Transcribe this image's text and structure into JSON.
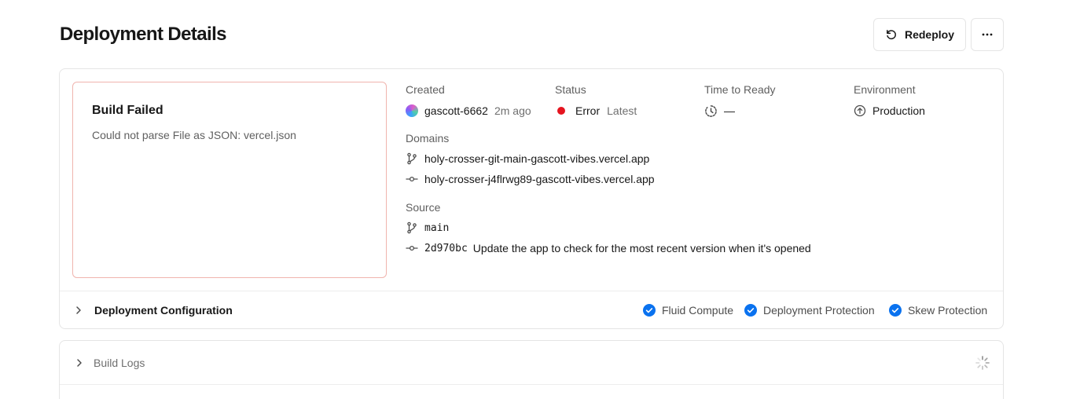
{
  "header": {
    "title": "Deployment Details",
    "redeploy_label": "Redeploy",
    "more_icon": "more-horizontal-icon"
  },
  "error": {
    "title": "Build Failed",
    "message": "Could not parse File as JSON: vercel.json"
  },
  "created": {
    "label": "Created",
    "user": "gascott-6662",
    "time": "2m ago"
  },
  "status": {
    "label": "Status",
    "value": "Error",
    "tag": "Latest",
    "color": "#e5141f"
  },
  "time_to_ready": {
    "label": "Time to Ready",
    "value": "—"
  },
  "environment": {
    "label": "Environment",
    "value": "Production"
  },
  "domains": {
    "label": "Domains",
    "items": [
      "holy-crosser-git-main-gascott-vibes.vercel.app",
      "holy-crosser-j4flrwg89-gascott-vibes.vercel.app"
    ]
  },
  "source": {
    "label": "Source",
    "branch": "main",
    "commit_hash": "2d970bc",
    "commit_message": "Update the app to check for the most recent version when it's opened"
  },
  "config": {
    "title": "Deployment Configuration",
    "features": [
      "Fluid Compute",
      "Deployment Protection",
      "Skew Protection"
    ],
    "accent": "#0a72ef"
  },
  "logs": {
    "title": "Build Logs"
  }
}
